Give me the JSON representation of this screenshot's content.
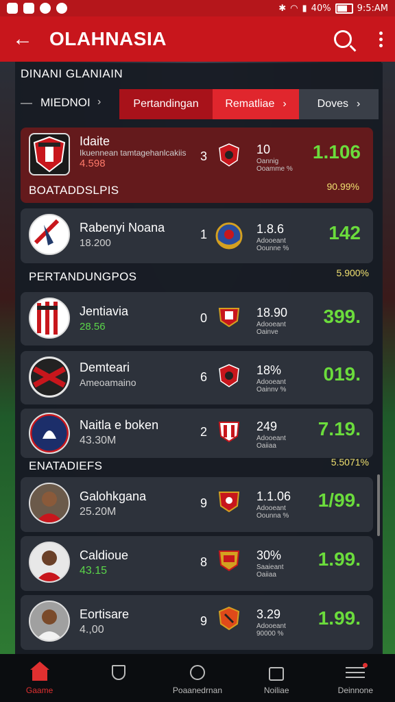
{
  "status_bar": {
    "battery": "40%",
    "time": "9:5:AM"
  },
  "app_bar": {
    "title": "OLAHNASIA"
  },
  "panel": {
    "section_title": "DINANI GLANIAIN",
    "menu_label": "MIEDNOI",
    "tabs": [
      {
        "label": "Pertandingan"
      },
      {
        "label": "Rematliae"
      },
      {
        "label": "Doves"
      }
    ]
  },
  "groups": [
    {
      "label": "BOATADDSLPIS",
      "pct": "90.99%"
    },
    {
      "label": "PERTANDUNGPOS",
      "pct": "5.900%"
    },
    {
      "label": "ENATADIEFS",
      "pct": "5.5071%"
    }
  ],
  "cards": [
    {
      "name": "Idaite",
      "sub": "Ikuennean tamtagehanlcakiis",
      "sub2": "4.598",
      "rank": "3",
      "stat": "10",
      "stat_sub": "Oannig Ooamme %",
      "score": "1.106"
    },
    {
      "name": "Rabenyi Noana",
      "sub": "18.200",
      "rank": "1",
      "stat": "1.8.6",
      "stat_sub": "Adooeant Oounne %",
      "score": "142"
    },
    {
      "name": "Jentiavia",
      "sub": "28.56",
      "rank": "0",
      "stat": "18.90",
      "stat_sub": "Adooeant Oainve",
      "score": "399."
    },
    {
      "name": "Demteari",
      "sub": "Ameoamaino",
      "rank": "6",
      "stat": "18%",
      "stat_sub": "Adooeant Oainnv %",
      "score": "019."
    },
    {
      "name": "Naitla e boken",
      "sub": "43.30M",
      "rank": "2",
      "stat": "249",
      "stat_sub": "Adooeant Oaiiaa",
      "score": "7.19."
    },
    {
      "name": "Galohkgana",
      "sub": "25.20M",
      "rank": "9",
      "stat": "1.1.06",
      "stat_sub": "Adooeant Oounna %",
      "score": "1/99."
    },
    {
      "name": "Caldioue",
      "sub": "43.15",
      "rank": "8",
      "stat": "30%",
      "stat_sub": "Saaieant Oaiiaa",
      "score": "1.99."
    },
    {
      "name": "Eortisare",
      "sub": "4.,00",
      "rank": "9",
      "stat": "3.29",
      "stat_sub": "Adooeant 90000 %",
      "score": "1.99."
    }
  ],
  "nav": [
    {
      "label": "Gaame",
      "icon": "home-icon"
    },
    {
      "label": "",
      "icon": "shield-icon"
    },
    {
      "label": "Poaanedrnan",
      "icon": "circle-icon"
    },
    {
      "label": "Noiliae",
      "icon": "bag-icon"
    },
    {
      "label": "Deinnone",
      "icon": "menu-icon"
    }
  ],
  "colors": {
    "brand_red": "#c8161c",
    "score_green": "#6bdc3c",
    "highlight": "#641a1c"
  }
}
